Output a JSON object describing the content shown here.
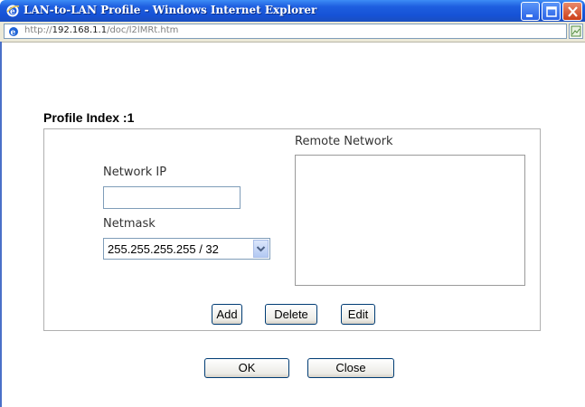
{
  "window": {
    "title": "LAN-to-LAN Profile - Windows Internet Explorer"
  },
  "address": {
    "url_prefix": "http://",
    "url_host": "192.168.1.1",
    "url_path": "/doc/l2lMRt.htm"
  },
  "profile": {
    "index_label": "Profile Index :1"
  },
  "form": {
    "network_ip_label": "Network IP",
    "network_ip_value": "",
    "netmask_label": "Netmask",
    "netmask_selected": "255.255.255.255 / 32",
    "remote_network_label": "Remote Network",
    "remote_network_items": []
  },
  "buttons": {
    "add": "Add",
    "delete": "Delete",
    "edit": "Edit",
    "ok": "OK",
    "close": "Close"
  },
  "colors": {
    "titlebar": "#1652d6",
    "title_text": "#ffffff",
    "button_border": "#003c74"
  },
  "icons": [
    "ie-logo-icon",
    "minimize-icon",
    "maximize-icon",
    "close-icon",
    "page-icon",
    "dropdown-arrow-icon"
  ]
}
